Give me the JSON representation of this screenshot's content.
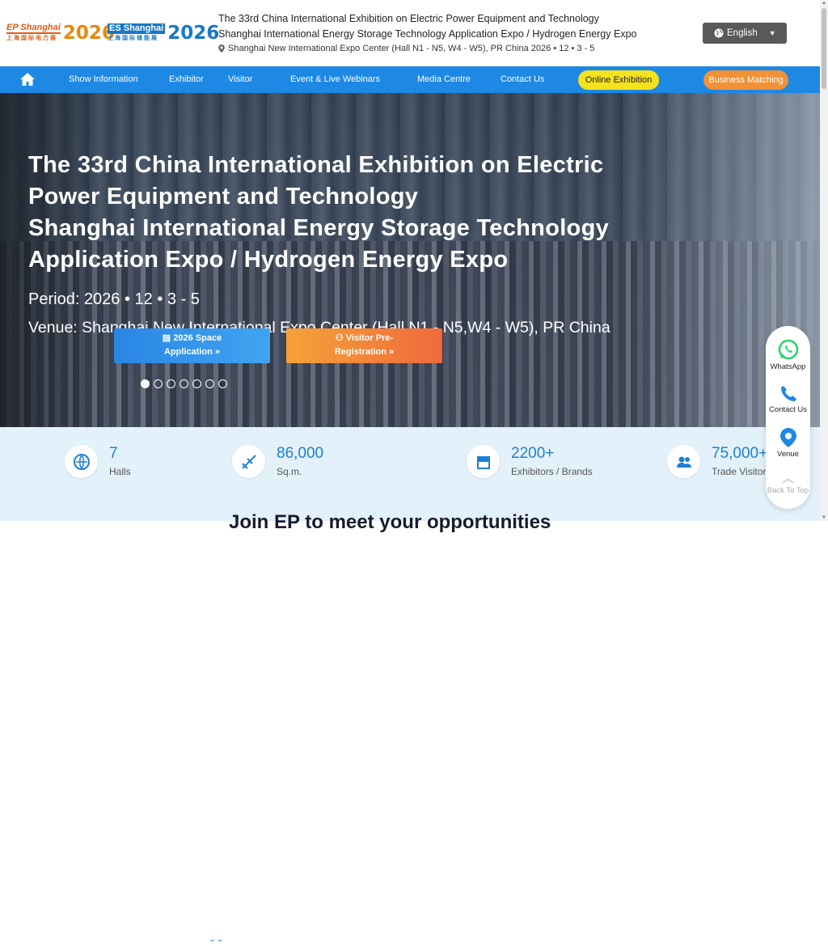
{
  "header": {
    "logo_ep": {
      "tag": "EP Shanghai",
      "cn": "上海国际电力展",
      "year": "2026"
    },
    "logo_es": {
      "tag": "ES Shanghai",
      "cn": "上海国际储能展",
      "year": "2026"
    },
    "title_line1": "The 33rd China International Exhibition on Electric Power Equipment and Technology",
    "title_line2": "Shanghai International Energy Storage Technology Application Expo / Hydrogen Energy Expo",
    "venue": "Shanghai New International Expo Center (Hall N1 - N5, W4 - W5), PR China 2026 • 12 • 3 - 5",
    "language": "English"
  },
  "nav": {
    "items": [
      "Show Information",
      "Exhibitor",
      "Visitor",
      "Event & Live Webinars",
      "Media Centre",
      "Contact Us"
    ],
    "online": "Online Exhibition",
    "matching": "Business Matching"
  },
  "hero": {
    "title_lines": [
      "The 33rd China International Exhibition on Electric",
      "Power Equipment and Technology",
      "Shanghai International Energy Storage Technology",
      "Application Expo / Hydrogen Energy Expo"
    ],
    "period": "Period: 2026 • 12 • 3 - 5",
    "venue": "Venue: Shanghai New International Expo Center (Hall N1 - N5,W4 - W5), PR China",
    "btn_space": {
      "line1": "2026 Space",
      "line2": "Application »"
    },
    "btn_visitor": {
      "line1": "Visitor Pre-",
      "line2": "Registration »"
    },
    "slides": 7,
    "active_slide": 1
  },
  "stats": [
    {
      "num": "7",
      "label": "Halls",
      "icon": "halls-icon"
    },
    {
      "num": "86,000",
      "label": "Sq.m.",
      "icon": "area-icon"
    },
    {
      "num": "2200+",
      "label": "Exhibitors / Brands",
      "icon": "exhibitors-icon"
    },
    {
      "num": "75,000+",
      "label": "Trade Visitors",
      "icon": "visitors-icon"
    }
  ],
  "bottom_heading": "Join EP to meet your opportunities",
  "side": {
    "whatsapp": "WhatsApp",
    "contact": "Contact Us",
    "venue": "Venue",
    "top": "Back To Top"
  },
  "colors": {
    "nav": "#1e88e5",
    "accent_blue": "#1c7fd8",
    "online_pill": "#f5e21c",
    "matching_pill": "#f29136"
  }
}
